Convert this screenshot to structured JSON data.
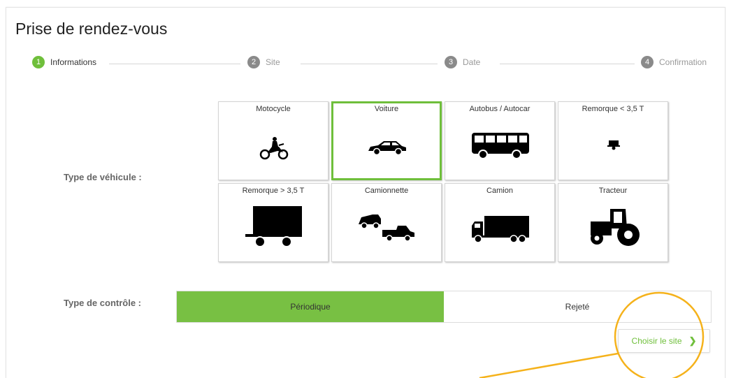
{
  "page": {
    "title": "Prise de rendez-vous"
  },
  "stepper": {
    "steps": [
      {
        "num": "1",
        "label": "Informations"
      },
      {
        "num": "2",
        "label": "Site"
      },
      {
        "num": "3",
        "label": "Date"
      },
      {
        "num": "4",
        "label": "Confirmation"
      }
    ],
    "active_step": 1
  },
  "vehicle": {
    "label": "Type de véhicule :",
    "types": [
      {
        "name": "Motocycle",
        "icon": "motorcycle-icon"
      },
      {
        "name": "Voiture",
        "icon": "car-icon",
        "selected": true
      },
      {
        "name": "Autobus / Autocar",
        "icon": "bus-icon"
      },
      {
        "name": "Remorque < 3,5 T",
        "icon": "small-trailer-icon"
      },
      {
        "name": "Remorque > 3,5 T",
        "icon": "large-trailer-icon"
      },
      {
        "name": "Camionnette",
        "icon": "van-icon"
      },
      {
        "name": "Camion",
        "icon": "truck-icon"
      },
      {
        "name": "Tracteur",
        "icon": "tractor-icon"
      }
    ]
  },
  "control": {
    "label": "Type de contrôle :",
    "options": [
      "Périodique",
      "Rejeté"
    ],
    "selected": "Périodique"
  },
  "next_button": {
    "label": "Choisir le site",
    "icon": "chevron-right-icon"
  },
  "colors": {
    "accent": "#6fbf3b",
    "annotation": "#f5b21b"
  }
}
